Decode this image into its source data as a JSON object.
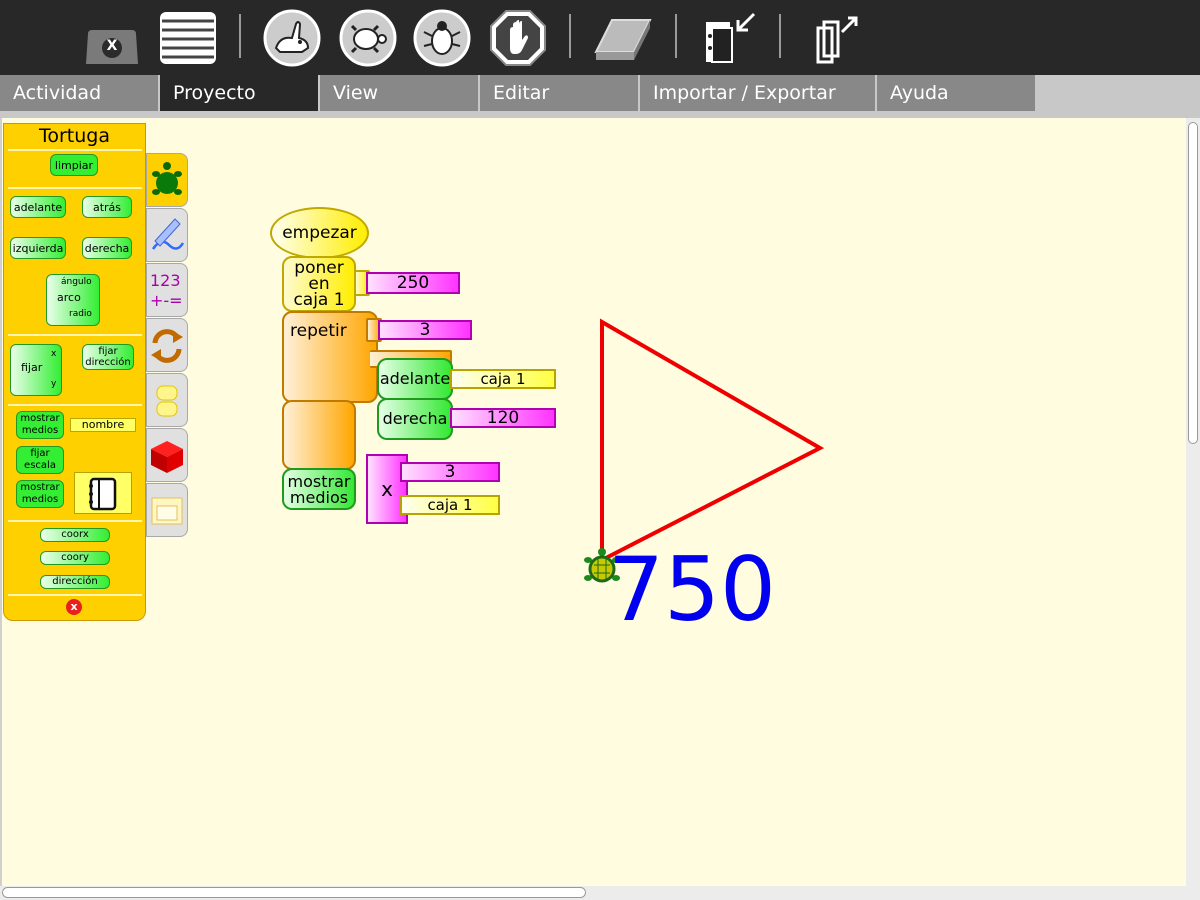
{
  "menu_tabs": [
    {
      "label": "Actividad"
    },
    {
      "label": "Proyecto"
    },
    {
      "label": "View"
    },
    {
      "label": "Editar"
    },
    {
      "label": "Importar / Exportar"
    },
    {
      "label": "Ayuda"
    }
  ],
  "toolbar": {
    "stop_badge": "X",
    "icons": [
      "stop-activity-icon",
      "palette-toggle-icon",
      "run-fast-icon",
      "run-slow-icon",
      "debug-step-icon",
      "stop-hand-icon",
      "eraser-icon",
      "collapse-blocks-icon",
      "expand-blocks-icon"
    ]
  },
  "palette": {
    "title": "Tortuga",
    "blocks": {
      "clean": "limpiar",
      "forward": "adelante",
      "back": "atrás",
      "left": "izquierda",
      "right": "derecha",
      "arc": "arco",
      "arc_angle": "ángulo",
      "arc_radius": "radio",
      "setxy": "fijar",
      "setxy_x": "x",
      "setxy_y": "y",
      "set_heading": "fijar dirección",
      "show_media": "mostrar medios",
      "name_slot": "nombre",
      "set_scale": "fijar escala",
      "show_media2": "mostrar medios",
      "xcor": "coorx",
      "ycor": "coory",
      "heading": "dirección",
      "close_badge": "x"
    }
  },
  "categories": [
    "turtle",
    "pen",
    "numbers",
    "flow",
    "blocks",
    "sensors",
    "media"
  ],
  "program": {
    "start": "empezar",
    "store_in_box_l1": "poner",
    "store_in_box_l2": "en",
    "store_in_box_l3": "caja 1",
    "store_value": "250",
    "repeat": "repetir",
    "repeat_count": "3",
    "forward": "adelante",
    "forward_arg": "caja 1",
    "right": "derecha",
    "right_arg": "120",
    "show_l1": "mostrar",
    "show_l2": "medios",
    "multiply_op": "x",
    "multiply_a": "3",
    "multiply_b": "caja 1"
  },
  "canvas": {
    "displayed_number": "750",
    "pen_color": "#ee0000",
    "number_color": "#0000ee"
  },
  "colors": {
    "toolbar_bg": "#282828",
    "tab_active": "#282828",
    "tab_inactive": "#888888",
    "canvas_bg": "#fffce0",
    "palette_bg": "#ffd000"
  }
}
